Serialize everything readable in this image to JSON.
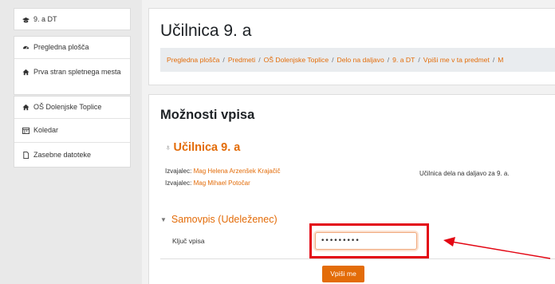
{
  "sidebar": {
    "course": {
      "label": "9. a DT",
      "icon": "graduation-cap-icon"
    },
    "items": [
      {
        "label": "Pregledna plošča",
        "icon": "dashboard-icon"
      },
      {
        "label": "Prva stran spletnega mesta",
        "icon": "home-icon"
      },
      {
        "label": "OŠ Dolenjske Toplice",
        "icon": "home-icon"
      },
      {
        "label": "Koledar",
        "icon": "calendar-icon"
      },
      {
        "label": "Zasebne datoteke",
        "icon": "file-icon"
      }
    ]
  },
  "header": {
    "title": "Učilnica 9. a",
    "breadcrumb": [
      "Pregledna plošča",
      "Predmeti",
      "OŠ Dolenjske Toplice",
      "Delo na daljavo",
      "9. a DT",
      "Vpiši me v ta predmet",
      "M"
    ]
  },
  "enrol": {
    "section_title": "Možnosti vpisa",
    "course_name": "Učilnica 9. a",
    "teachers": [
      {
        "role": "Izvajalec:",
        "name": "Mag Helena Arzenšek Krajačič"
      },
      {
        "role": "Izvajalec:",
        "name": "Mag Mihael Potočar"
      }
    ],
    "summary": "Učilnica dela na daljavo za 9. a.",
    "method_title": "Samovpis (Udeleženec)",
    "key_label": "Ključ vpisa",
    "key_value": "•••••••••",
    "submit_label": "Vpiši me"
  },
  "colors": {
    "accent": "#e36c09",
    "annotation": "#e30613"
  }
}
